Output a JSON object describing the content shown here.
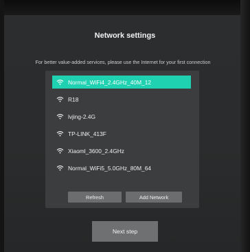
{
  "header": {
    "title": "Network settings",
    "subtitle": "For better value-added services, please use the Internet for your first connection"
  },
  "networks": [
    {
      "ssid": "Normal_WiFi4_2.4GHz_40M_12",
      "selected": true,
      "icon": "wifi-icon"
    },
    {
      "ssid": "R18",
      "selected": false,
      "icon": "wifi-icon"
    },
    {
      "ssid": "lvjing-2.4G",
      "selected": false,
      "icon": "wifi-icon"
    },
    {
      "ssid": "TP-LINK_413F",
      "selected": false,
      "icon": "wifi-icon"
    },
    {
      "ssid": "Xiaoml_3600_2.4GHz",
      "selected": false,
      "icon": "wifi-icon"
    },
    {
      "ssid": "Normal_WiFi5_5.0GHz_80M_64",
      "selected": false,
      "icon": "wifi-icon"
    }
  ],
  "buttons": {
    "refresh": "Refresh",
    "add_network": "Add Network",
    "next_step": "Next step"
  },
  "colors": {
    "selection": "#1fd0b1",
    "panel": "#3b3d3f",
    "background": "#2a2c2d"
  }
}
